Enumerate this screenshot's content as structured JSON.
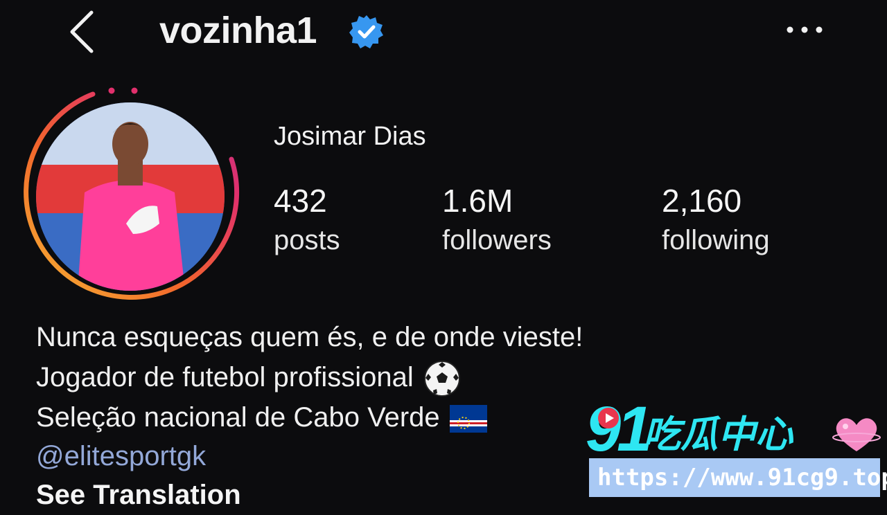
{
  "header": {
    "username": "vozinha1",
    "back_icon": "chevron-left-icon",
    "verified_icon": "verified-badge-icon",
    "more_icon": "ellipsis-icon"
  },
  "profile": {
    "display_name": "Josimar Dias",
    "stats": [
      {
        "value": "432",
        "label": "posts"
      },
      {
        "value": "1.6M",
        "label": "followers"
      },
      {
        "value": "2,160",
        "label": "following"
      }
    ]
  },
  "bio": {
    "line1": "Nunca esqueças quem és, e de onde vieste!",
    "line2": "Jogador de futebol profissional",
    "line2_emoji": "soccer-ball-icon",
    "line3": "Seleção nacional de Cabo Verde",
    "line3_emoji": "cape-verde-flag-icon",
    "link": "@elitesportgk",
    "see_translation": "See Translation"
  },
  "watermark": {
    "number": "91",
    "chinese": "吃瓜中心",
    "url": "https://www.91cg9.top"
  },
  "colors": {
    "background": "#0c0c0e",
    "link": "#93a8d8",
    "verified": "#3797f0",
    "watermark_cyan": "#2ee6f2"
  }
}
